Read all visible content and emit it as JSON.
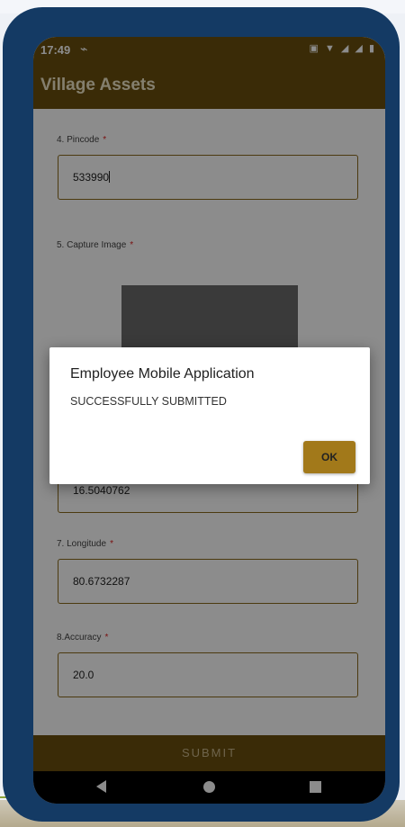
{
  "status_bar": {
    "time": "17:49",
    "icons": [
      "cast-icon",
      "signal-icon",
      "battery-icon"
    ]
  },
  "app": {
    "title": "Village Assets"
  },
  "form": {
    "pincode": {
      "label": "4. Pincode",
      "required": "*",
      "value": "533990"
    },
    "capture_image": {
      "label": "5. Capture Image",
      "required": "*"
    },
    "latitude": {
      "value": "16.5040762"
    },
    "longitude": {
      "label": "7. Longitude",
      "required": "*",
      "value": "80.6732287"
    },
    "accuracy": {
      "label": "8.Accuracy",
      "required": "*",
      "value": "20.0"
    },
    "submit_label": "SUBMIT"
  },
  "dialog": {
    "title": "Employee Mobile Application",
    "message": "SUCCESSFULLY SUBMITTED",
    "ok_label": "OK"
  },
  "colors": {
    "primary": "#6b4f0d",
    "accent": "#a2791a",
    "frame": "#143a64"
  }
}
